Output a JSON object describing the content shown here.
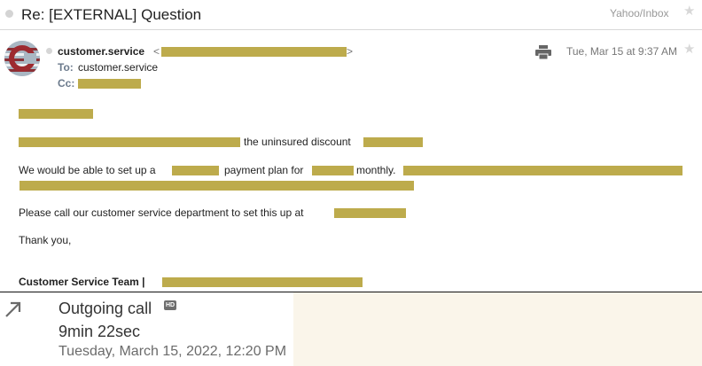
{
  "subject_bar": {
    "subject": "Re: [EXTERNAL] Question",
    "folder": "Yahoo/Inbox"
  },
  "header": {
    "sender_name": "customer.service",
    "email_open": "<",
    "email_close": ">",
    "to_label": "To:",
    "to_value": "customer.service",
    "cc_label": "Cc:",
    "date": "Tue, Mar 15 at 9:37 AM"
  },
  "body": {
    "line1_text": "the uninsured discount",
    "line2_a": "We would be able to set up a",
    "line2_b": "payment plan for",
    "line2_c": "monthly.",
    "line3": "Please call our customer service department to set this up at",
    "line4": "Thank you,",
    "signature": "Customer Service Team |"
  },
  "call": {
    "type": "Outgoing call",
    "hd_badge": "HD",
    "duration": "9min 22sec",
    "date": "Tuesday, March 15, 2022, 12:20 PM"
  },
  "colors": {
    "redaction": "#bdab4c",
    "call_panel": "#faf5ea"
  }
}
